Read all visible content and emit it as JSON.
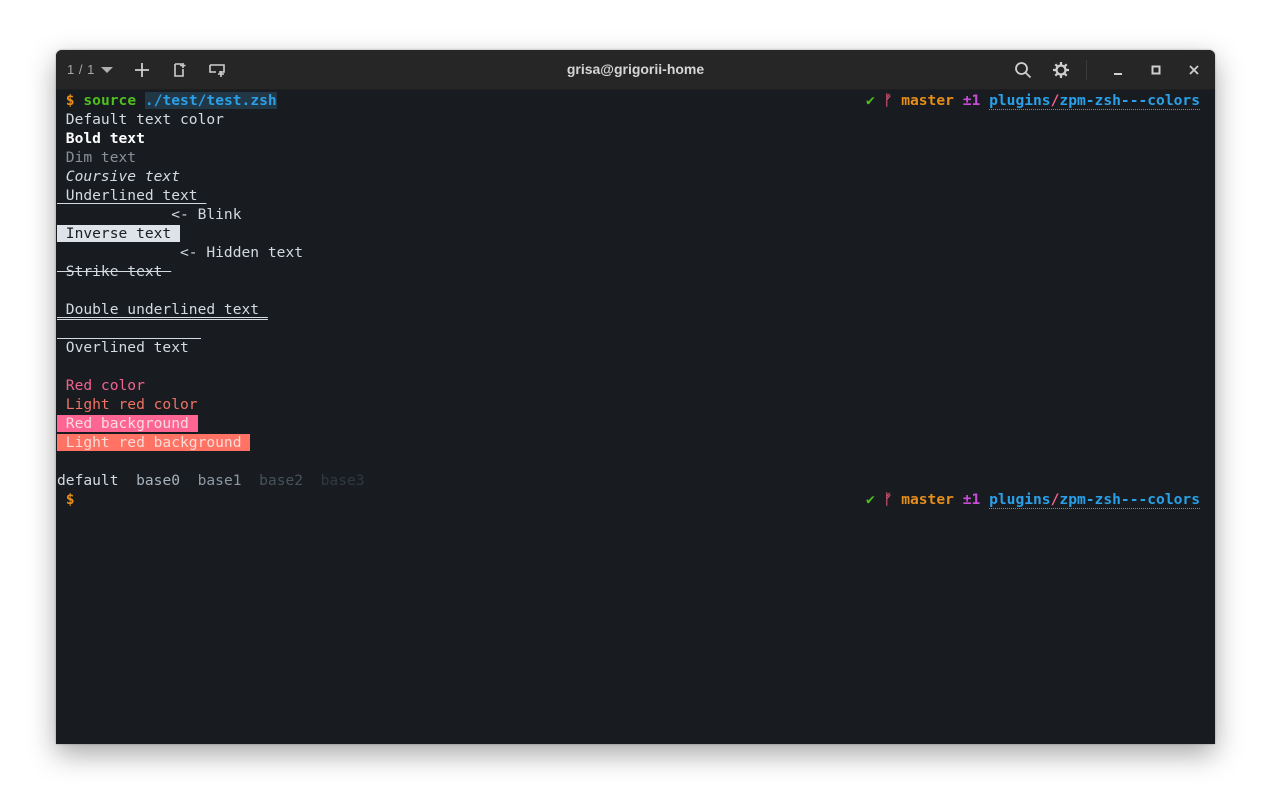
{
  "window": {
    "title": "grisa@grigorii-home",
    "tab_counter": "1 / 1",
    "toolbar_icons": [
      "chevron-down-icon",
      "plus-icon",
      "new-tab-icon",
      "new-window-icon"
    ],
    "right_icons": [
      "search-icon",
      "gear-icon",
      "minimize-icon",
      "maximize-icon",
      "close-icon"
    ]
  },
  "prompt": {
    "symbol": "$",
    "command": "source",
    "argument": "./test/test.zsh"
  },
  "rprompt": {
    "status_icon": "✔",
    "branch_icon": "ᚠ",
    "branch": "master",
    "dirty": "±1",
    "path_dir": "plugins",
    "path_sep": "/",
    "path_leaf": "zpm-zsh---colors"
  },
  "output": {
    "default": " Default text color",
    "bold": " Bold text",
    "dim": " Dim text",
    "italic": " Coursive text",
    "underline": " Underlined text ",
    "blink": "             <- Blink",
    "inverse": " Inverse text ",
    "hidden": "              <- Hidden text",
    "strike": " Strike text ",
    "double_underline": " Double underlined text ",
    "overline": " Overlined text",
    "red": " Red color",
    "light_red": " Light red color",
    "red_bg": " Red background ",
    "light_red_bg": " Light red background ",
    "base_default": "default",
    "base0": "base0",
    "base1": "base1",
    "base2": "base2",
    "base3": "base3"
  },
  "final_prompt": {
    "symbol": " $"
  },
  "colors": {
    "background": "#181c20",
    "titlebar": "#262626",
    "prompt": "#e68d1a",
    "command": "#4fbf1f",
    "path": "#2aa0e8",
    "red": "#f2628e",
    "light_red": "#ef7263",
    "red_bg": "#ff6593",
    "light_red_bg": "#ff7264"
  }
}
